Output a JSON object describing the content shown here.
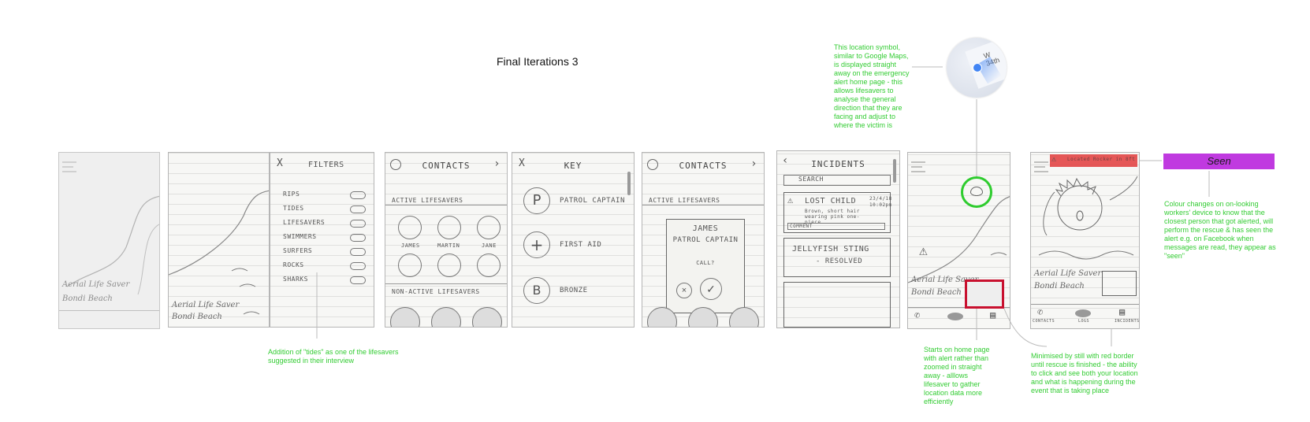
{
  "title": "Final Iterations 3",
  "seen_label": "Seen",
  "colors": {
    "annotation": "#33cc33",
    "seen": "#c03ae0",
    "alert_red": "#e23c3c",
    "highlight_green": "#2ecc2e",
    "highlight_red": "#c8102e"
  },
  "notes": {
    "tides": "Addition of \"tides\" as one of the lifesavers suggested in their interview",
    "location": "This location symbol, similar to Google Maps, is displayed straight away on the emergency alert home page - this allows lifesavers to analyse the general direction that they are facing and adjust to where the victim is",
    "home": "Starts on home page with alert rather than zoomed in straight away - alllows lifesaver to gather location data more efficiently",
    "minimised": "Minimised by still with red border until rescue is finished - the ability to click and see both your location and what is happening during the event that is taking place",
    "colour": "Colour changes on on-looking workers' device to know that the closest person that got alerted, will perform the rescue & has seen the alert e.g. on Facebook when messages are read, they appear as \"seen\""
  },
  "map_label": "W 34th",
  "screens": {
    "home": {
      "l1": "Aerial Life Saver",
      "l2": "Bondi Beach"
    },
    "filters": {
      "header": "FILTERS",
      "close": "X",
      "items": [
        "RIPS",
        "TIDES",
        "LIFESAVERS",
        "SWIMMERS",
        "SURFERS",
        "ROCKS",
        "SHARKS"
      ]
    },
    "contacts": {
      "header": "CONTACTS",
      "active": "ACTIVE LIFESAVERS",
      "inactive": "NON-ACTIVE LIFESAVERS",
      "names": [
        "JAMES",
        "MARTIN",
        "JANE"
      ]
    },
    "key": {
      "header": "KEY",
      "close": "X",
      "items": [
        "PATROL CAPTAIN",
        "FIRST AID",
        "BRONZE"
      ],
      "glyphs": [
        "P",
        "+",
        "B"
      ]
    },
    "call": {
      "name": "JAMES",
      "role": "PATROL CAPTAIN",
      "prompt": "CALL?"
    },
    "incidents": {
      "header": "INCIDENTS",
      "search": "SEARCH",
      "item1": "LOST CHILD",
      "item1_date": "23/4/18",
      "item1_time": "10:02pm",
      "item1_desc": "Brown, short hair wearing pink one-piece",
      "item1_comment": "COMMENT",
      "item2": "JELLYFISH STING",
      "item2_status": "- RESOLVED"
    },
    "nav": [
      "CONTACTS",
      "LOGS",
      "INCIDENTS"
    ],
    "alert_bar": "Located Rocker in 8ft"
  }
}
